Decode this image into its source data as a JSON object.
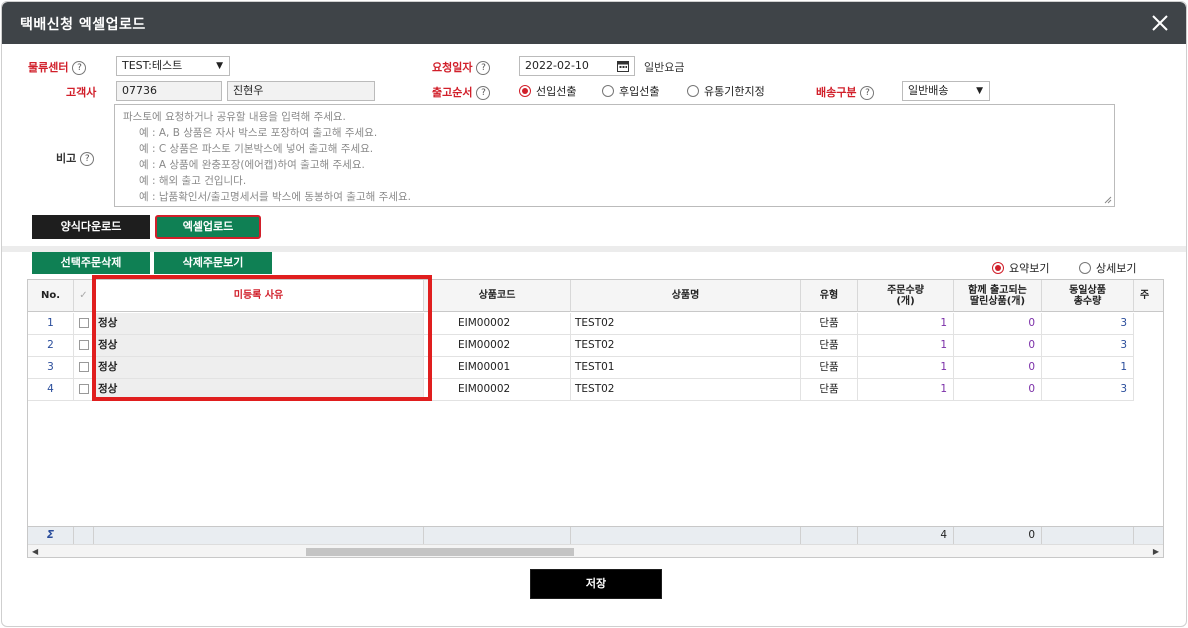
{
  "dialog": {
    "title": "택배신청 엑셀업로드",
    "close_glyph": "✕"
  },
  "form": {
    "center_label": "물류센터",
    "center_value": "TEST:테스트",
    "date_label": "요청일자",
    "date_value": "2022-02-10",
    "fee_text": "일반요금",
    "customer_label": "고객사",
    "customer_code": "07736",
    "customer_name": "진현우",
    "order_label": "출고순서",
    "order_options": [
      "선입선출",
      "후입선출",
      "유통기한지정"
    ],
    "order_selected": "선입선출",
    "delivery_label": "배송구분",
    "delivery_value": "일반배송",
    "memo_label": "비고",
    "help_glyph": "?",
    "memo_placeholder": [
      "파스토에 요청하거나 공유할 내용을 입력해 주세요.",
      "예 : A, B 상품은 자사 박스로 포장하여 출고해 주세요.",
      "예 : C 상품은 파스토 기본박스에 넣어 출고해 주세요.",
      "예 : A 상품에 완충포장(에어캡)하여 출고해 주세요.",
      "예 : 해외 출고 건입니다.",
      "예 : 납품확인서/출고명세서를 박스에 동봉하여 출고해 주세요."
    ]
  },
  "buttons": {
    "template_download": "양식다운로드",
    "excel_upload": "엑셀업로드",
    "delete_selected": "선택주문삭제",
    "view_deleted": "삭제주문보기",
    "save": "저장"
  },
  "view_toggle": {
    "summary": "요약보기",
    "detail": "상세보기",
    "selected": "요약보기"
  },
  "grid": {
    "headers": {
      "no": "No.",
      "reason": "미등록 사유",
      "code": "상품코드",
      "name": "상품명",
      "type": "유형",
      "qty": "주문수량\n(개)",
      "bundled": "함께 출고되는\n딸린상품(개)",
      "same_total": "동일상품\n총수량",
      "partial": "주"
    },
    "rows": [
      {
        "no": "1",
        "reason": "정상",
        "code": "EIM00002",
        "name": "TEST02",
        "type": "단품",
        "qty": "1",
        "bundled": "0",
        "same_total": "3"
      },
      {
        "no": "2",
        "reason": "정상",
        "code": "EIM00002",
        "name": "TEST02",
        "type": "단품",
        "qty": "1",
        "bundled": "0",
        "same_total": "3"
      },
      {
        "no": "3",
        "reason": "정상",
        "code": "EIM00001",
        "name": "TEST01",
        "type": "단품",
        "qty": "1",
        "bundled": "0",
        "same_total": "1"
      },
      {
        "no": "4",
        "reason": "정상",
        "code": "EIM00002",
        "name": "TEST02",
        "type": "단품",
        "qty": "1",
        "bundled": "0",
        "same_total": "3"
      }
    ],
    "summary": {
      "sigma": "Σ",
      "qty_total": "4",
      "bundled_total": "0"
    }
  },
  "colors": {
    "title_bar": "#3f4448",
    "required_label": "#d11f2a",
    "green_button": "#0f8054",
    "dark_button": "#1e1e1e",
    "highlight_box": "#e01e1e"
  }
}
